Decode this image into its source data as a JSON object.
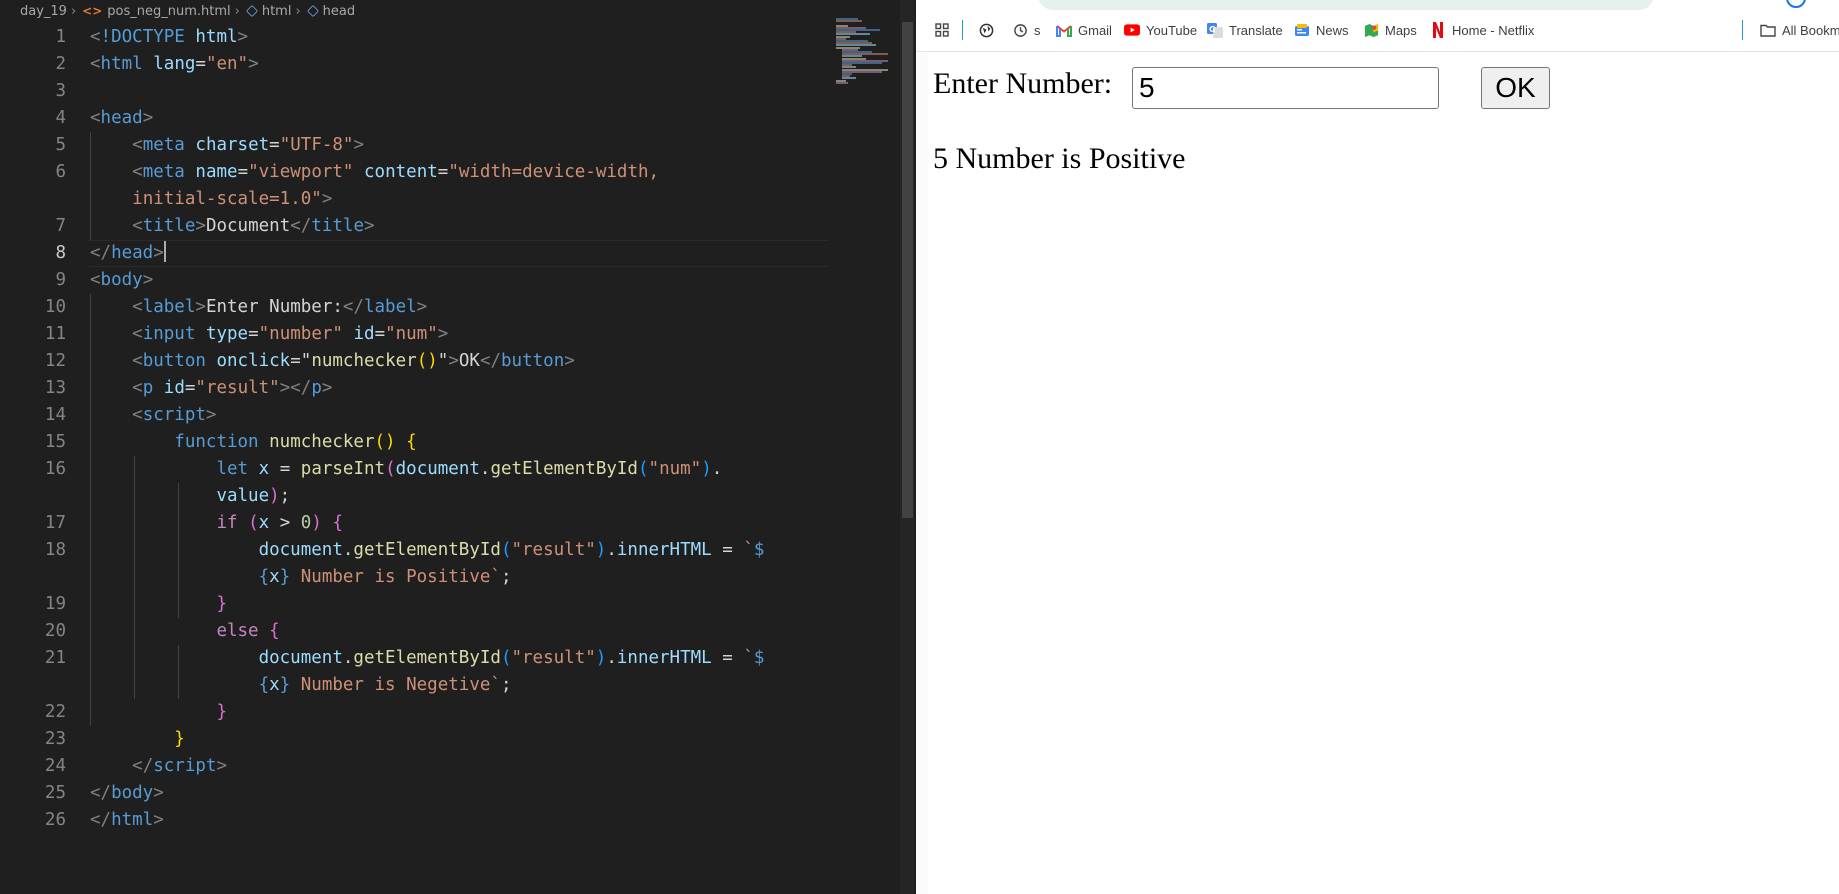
{
  "editor": {
    "breadcrumb": [
      "day_19",
      "pos_neg_num.html",
      "html",
      "head"
    ],
    "lines": [
      {
        "n": "1",
        "html": "<span class='t-br'>&lt;</span><span class='t-tag'>!DOCTYPE</span> <span class='t-att'>html</span><span class='t-br'>&gt;</span>"
      },
      {
        "n": "2",
        "html": "<span class='t-br'>&lt;</span><span class='t-tag'>html</span> <span class='t-att'>lang</span><span class='t-txt'>=</span><span class='t-str'>\"en\"</span><span class='t-br'>&gt;</span>"
      },
      {
        "n": "3",
        "html": ""
      },
      {
        "n": "4",
        "html": "<span class='t-br'>&lt;</span><span class='t-tag'>head</span><span class='t-br'>&gt;</span>"
      },
      {
        "n": "5",
        "html": "    <span class='t-br'>&lt;</span><span class='t-tag'>meta</span> <span class='t-att'>charset</span><span class='t-txt'>=</span><span class='t-str'>\"UTF-8\"</span><span class='t-br'>&gt;</span>"
      },
      {
        "n": "6",
        "html": "    <span class='t-br'>&lt;</span><span class='t-tag'>meta</span> <span class='t-att'>name</span><span class='t-txt'>=</span><span class='t-str'>\"viewport\"</span> <span class='t-att'>content</span><span class='t-txt'>=</span><span class='t-str'>\"width=device-width,</span>"
      },
      {
        "n": "",
        "html": "    <span class='t-str'>initial-scale=1.0\"</span><span class='t-br'>&gt;</span>"
      },
      {
        "n": "7",
        "html": "    <span class='t-br'>&lt;</span><span class='t-tag'>title</span><span class='t-br'>&gt;</span><span class='t-txt'>Document</span><span class='t-br'>&lt;/</span><span class='t-tag'>title</span><span class='t-br'>&gt;</span>"
      },
      {
        "n": "8",
        "html": "<span class='t-br'>&lt;/</span><span class='t-tag'>head</span><span class='t-br'>&gt;</span><span class='caret'></span>"
      },
      {
        "n": "9",
        "html": "<span class='t-br'>&lt;</span><span class='t-tag'>body</span><span class='t-br'>&gt;</span>"
      },
      {
        "n": "10",
        "html": "    <span class='t-br'>&lt;</span><span class='t-tag'>label</span><span class='t-br'>&gt;</span><span class='t-txt'>Enter Number:</span><span class='t-br'>&lt;/</span><span class='t-tag'>label</span><span class='t-br'>&gt;</span>"
      },
      {
        "n": "11",
        "html": "    <span class='t-br'>&lt;</span><span class='t-tag'>input</span> <span class='t-att'>type</span><span class='t-txt'>=</span><span class='t-str'>\"number\"</span> <span class='t-att'>id</span><span class='t-txt'>=</span><span class='t-str'>\"num\"</span><span class='t-br'>&gt;</span>"
      },
      {
        "n": "12",
        "html": "    <span class='t-br'>&lt;</span><span class='t-tag'>button</span> <span class='t-att'>onclick</span><span class='t-txt'>=</span><span class='t-txt'>\"</span><span class='t-fn'>numchecker</span><span class='t-b1'>()</span><span class='t-txt'>\"</span><span class='t-br'>&gt;</span><span class='t-txt'>OK</span><span class='t-br'>&lt;/</span><span class='t-tag'>button</span><span class='t-br'>&gt;</span>"
      },
      {
        "n": "13",
        "html": "    <span class='t-br'>&lt;</span><span class='t-tag'>p</span> <span class='t-att'>id</span><span class='t-txt'>=</span><span class='t-str'>\"result\"</span><span class='t-br'>&gt;&lt;/</span><span class='t-tag'>p</span><span class='t-br'>&gt;</span>"
      },
      {
        "n": "14",
        "html": "    <span class='t-br'>&lt;</span><span class='t-tag'>script</span><span class='t-br'>&gt;</span>"
      },
      {
        "n": "15",
        "html": "        <span class='t-kw'>function</span> <span class='t-fn'>numchecker</span><span class='t-b1'>()</span> <span class='t-b1'>{</span>"
      },
      {
        "n": "16",
        "html": "            <span class='t-kw'>let</span> <span class='t-var'>x</span> <span class='t-txt'>=</span> <span class='t-fn'>parseInt</span><span class='t-b2'>(</span><span class='t-var'>document</span><span class='t-txt'>.</span><span class='t-fn'>getElementById</span><span class='t-b3'>(</span><span class='t-str'>\"num\"</span><span class='t-b3'>)</span><span class='t-txt'>.</span>"
      },
      {
        "n": "",
        "html": "            <span class='t-var'>value</span><span class='t-b2'>)</span><span class='t-txt'>;</span>"
      },
      {
        "n": "17",
        "html": "            <span class='t-ctl'>if</span> <span class='t-b2'>(</span><span class='t-var'>x</span> <span class='t-txt'>&gt;</span> <span class='t-num'>0</span><span class='t-b2'>)</span> <span class='t-b2'>{</span>"
      },
      {
        "n": "18",
        "html": "                <span class='t-var'>document</span><span class='t-txt'>.</span><span class='t-fn'>getElementById</span><span class='t-b3'>(</span><span class='t-str'>\"result\"</span><span class='t-b3'>)</span><span class='t-txt'>.</span><span class='t-var'>innerHTML</span> <span class='t-txt'>=</span> <span class='t-str'>`</span><span class='t-kw'>$</span>"
      },
      {
        "n": "",
        "html": "                <span class='t-kw'>{</span><span class='t-var'>x</span><span class='t-kw'>}</span><span class='t-str'> Number is Positive`</span><span class='t-txt'>;</span>"
      },
      {
        "n": "19",
        "html": "            <span class='t-b2'>}</span>"
      },
      {
        "n": "20",
        "html": "            <span class='t-ctl'>else</span> <span class='t-b2'>{</span>"
      },
      {
        "n": "21",
        "html": "                <span class='t-var'>document</span><span class='t-txt'>.</span><span class='t-fn'>getElementById</span><span class='t-b3'>(</span><span class='t-str'>\"result\"</span><span class='t-b3'>)</span><span class='t-txt'>.</span><span class='t-var'>innerHTML</span> <span class='t-txt'>=</span> <span class='t-str'>`</span><span class='t-kw'>$</span>"
      },
      {
        "n": "",
        "html": "                <span class='t-kw'>{</span><span class='t-var'>x</span><span class='t-kw'>}</span><span class='t-str'> Number is Negetive`</span><span class='t-txt'>;</span>"
      },
      {
        "n": "22",
        "html": "            <span class='t-b2'>}</span>"
      },
      {
        "n": "23",
        "html": "        <span class='t-b1'>}</span>"
      },
      {
        "n": "24",
        "html": "    <span class='t-br'>&lt;/</span><span class='t-tag'>script</span><span class='t-br'>&gt;</span>"
      },
      {
        "n": "25",
        "html": "<span class='t-br'>&lt;/</span><span class='t-tag'>body</span><span class='t-br'>&gt;</span>"
      },
      {
        "n": "26",
        "html": "<span class='t-br'>&lt;/</span><span class='t-tag'>html</span><span class='t-br'>&gt;</span>"
      }
    ],
    "current_line": "8"
  },
  "browser": {
    "bookmarks": [
      {
        "label": "",
        "icon": "apps-grid-icon"
      },
      {
        "label": "",
        "icon": "globe-icon"
      },
      {
        "label": "s",
        "icon": "history-icon"
      },
      {
        "label": "Gmail",
        "icon": "gmail-icon"
      },
      {
        "label": "YouTube",
        "icon": "youtube-icon"
      },
      {
        "label": "Translate",
        "icon": "translate-icon"
      },
      {
        "label": "News",
        "icon": "news-icon"
      },
      {
        "label": "Maps",
        "icon": "maps-icon"
      },
      {
        "label": "Home - Netflix",
        "icon": "netflix-icon"
      },
      {
        "label": "All Bookm",
        "icon": "folder-icon"
      }
    ],
    "page": {
      "label": "Enter Number:",
      "input_value": "5",
      "button_label": "OK",
      "result": "5 Number is Positive"
    }
  },
  "colors": {
    "editor_bg": "#1f1f1f",
    "tag": "#569cd6",
    "attribute": "#9cdcfe",
    "string": "#ce9178",
    "function": "#dcdcaa",
    "control": "#c586c0"
  }
}
